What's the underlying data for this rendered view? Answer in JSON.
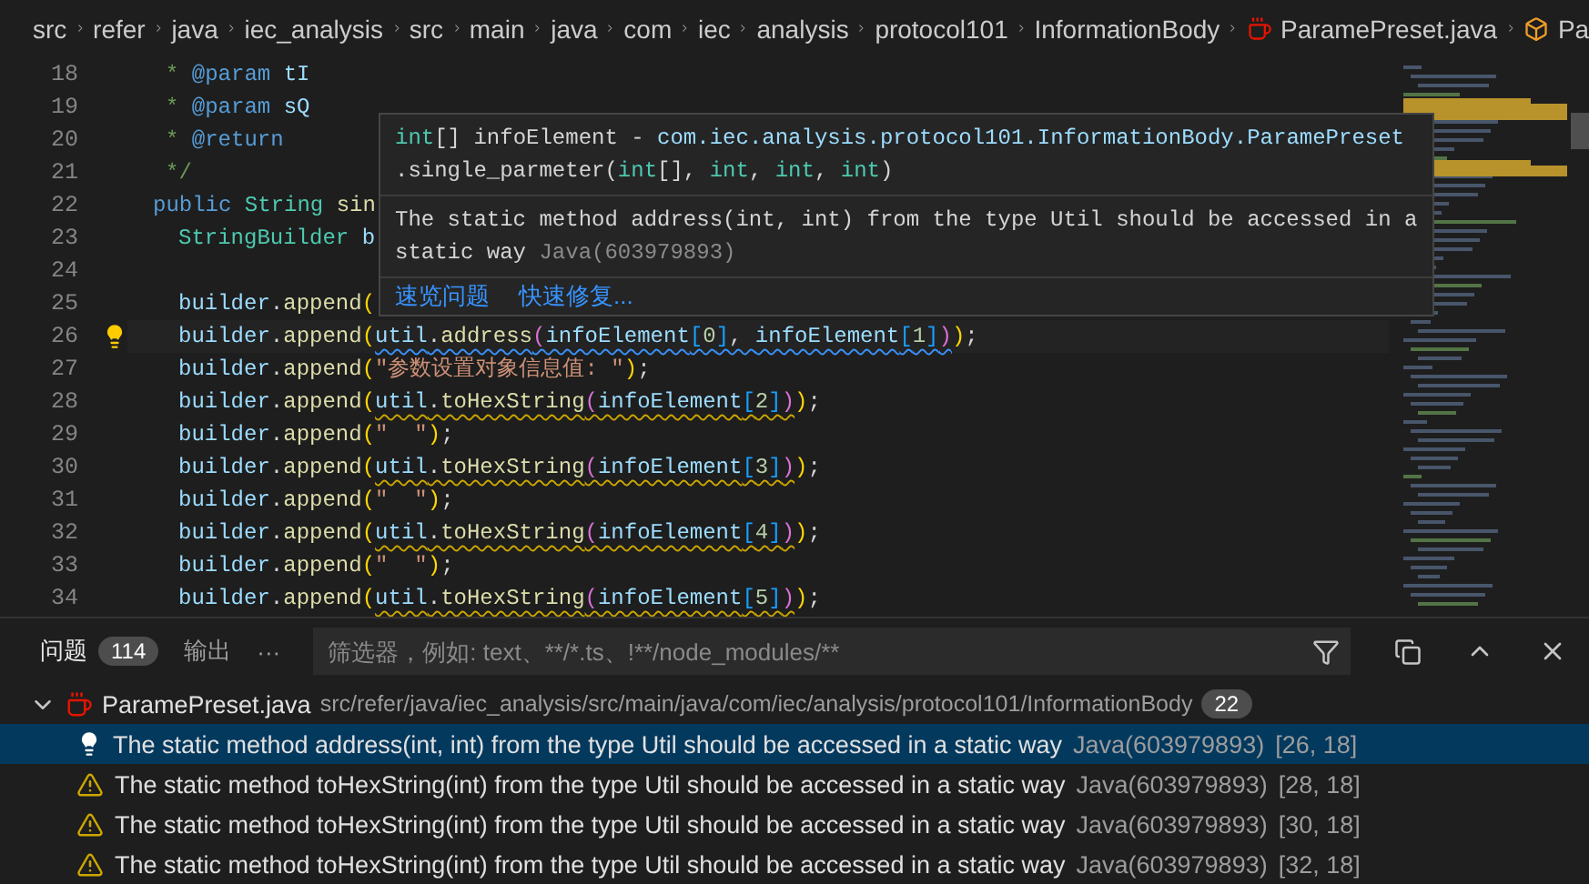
{
  "breadcrumbs": [
    {
      "label": "src",
      "kind": "folder"
    },
    {
      "label": "refer",
      "kind": "folder"
    },
    {
      "label": "java",
      "kind": "folder"
    },
    {
      "label": "iec_analysis",
      "kind": "folder"
    },
    {
      "label": "src",
      "kind": "folder"
    },
    {
      "label": "main",
      "kind": "folder"
    },
    {
      "label": "java",
      "kind": "folder"
    },
    {
      "label": "com",
      "kind": "folder"
    },
    {
      "label": "iec",
      "kind": "folder"
    },
    {
      "label": "analysis",
      "kind": "folder"
    },
    {
      "label": "protocol101",
      "kind": "folder"
    },
    {
      "label": "InformationBody",
      "kind": "folder"
    },
    {
      "label": "ParamePreset.java",
      "kind": "java"
    },
    {
      "label": "Pa",
      "kind": "symbol"
    }
  ],
  "editor": {
    "lines": [
      {
        "number": "18",
        "bulb": false,
        "kind": "doc",
        "tokens": [
          {
            "text": "* ",
            "kind": "comment"
          },
          {
            "text": "@param",
            "kind": "tag"
          },
          {
            "text": " tI",
            "kind": "var"
          }
        ]
      },
      {
        "number": "19",
        "bulb": false,
        "kind": "doc",
        "tokens": [
          {
            "text": "* ",
            "kind": "comment"
          },
          {
            "text": "@param",
            "kind": "tag"
          },
          {
            "text": " sQ",
            "kind": "var"
          }
        ]
      },
      {
        "number": "20",
        "bulb": false,
        "kind": "doc",
        "tokens": [
          {
            "text": "* ",
            "kind": "comment"
          },
          {
            "text": "@return",
            "kind": "tag"
          }
        ]
      },
      {
        "number": "21",
        "bulb": false,
        "kind": "doc",
        "tokens": [
          {
            "text": "*/",
            "kind": "comment"
          }
        ]
      },
      {
        "number": "22",
        "bulb": false,
        "kind": "decl",
        "tokens": [
          {
            "text": "public",
            "kind": "keyword"
          },
          {
            "text": " String",
            "kind": "type"
          },
          {
            "text": " sin",
            "kind": "fn"
          }
        ]
      },
      {
        "number": "23",
        "bulb": false,
        "kind": "body",
        "tokens": [
          {
            "text": "StringBuilder",
            "kind": "type"
          },
          {
            "text": " b",
            "kind": "var"
          }
        ]
      },
      {
        "number": "24",
        "bulb": false,
        "kind": "blank"
      },
      {
        "number": "25",
        "bulb": false,
        "kind": "body",
        "tokens": [
          {
            "text": "builder",
            "kind": "var"
          },
          {
            "text": ".",
            "kind": "plain"
          },
          {
            "text": "append",
            "kind": "fn"
          },
          {
            "text": "(",
            "kind": "bracket1"
          }
        ]
      },
      {
        "number": "26",
        "bulb": true,
        "kind": "body",
        "tokens": [
          {
            "text": "builder",
            "kind": "var"
          },
          {
            "text": ".",
            "kind": "plain"
          },
          {
            "text": "append",
            "kind": "fn"
          },
          {
            "text": "(",
            "kind": "bracket1"
          },
          {
            "kind": "info",
            "tokens": [
              {
                "text": "util",
                "kind": "var"
              },
              {
                "text": ".",
                "kind": "plain"
              },
              {
                "text": "address",
                "kind": "fn"
              },
              {
                "text": "(",
                "kind": "bracket2"
              },
              {
                "text": "infoElement",
                "kind": "var"
              },
              {
                "text": "[",
                "kind": "bracket3"
              },
              {
                "text": "0",
                "kind": "number"
              },
              {
                "text": "]",
                "kind": "bracket3"
              },
              {
                "text": ", ",
                "kind": "plain"
              },
              {
                "text": "infoElement",
                "kind": "var"
              },
              {
                "text": "[",
                "kind": "bracket3"
              },
              {
                "text": "1",
                "kind": "number"
              },
              {
                "text": "]",
                "kind": "bracket3"
              },
              {
                "text": ")",
                "kind": "bracket2"
              }
            ]
          },
          {
            "text": ")",
            "kind": "bracket1"
          },
          {
            "text": ";",
            "kind": "plain"
          }
        ]
      },
      {
        "number": "27",
        "bulb": false,
        "kind": "body",
        "tokens": [
          {
            "text": "builder",
            "kind": "var"
          },
          {
            "text": ".",
            "kind": "plain"
          },
          {
            "text": "append",
            "kind": "fn"
          },
          {
            "text": "(",
            "kind": "bracket1"
          },
          {
            "text": "\"参数设置对象信息值: \"",
            "kind": "string"
          },
          {
            "text": ")",
            "kind": "bracket1"
          },
          {
            "text": ";",
            "kind": "plain"
          }
        ]
      },
      {
        "number": "28",
        "bulb": false,
        "kind": "body",
        "tokens": [
          {
            "text": "builder",
            "kind": "var"
          },
          {
            "text": ".",
            "kind": "plain"
          },
          {
            "text": "append",
            "kind": "fn"
          },
          {
            "text": "(",
            "kind": "bracket1"
          },
          {
            "kind": "warning",
            "tokens": [
              {
                "text": "util",
                "kind": "var"
              },
              {
                "text": ".",
                "kind": "plain"
              },
              {
                "text": "toHexString",
                "kind": "fn"
              },
              {
                "text": "(",
                "kind": "bracket2"
              },
              {
                "text": "infoElement",
                "kind": "var"
              },
              {
                "text": "[",
                "kind": "bracket3"
              },
              {
                "text": "2",
                "kind": "number"
              },
              {
                "text": "]",
                "kind": "bracket3"
              },
              {
                "text": ")",
                "kind": "bracket2"
              }
            ]
          },
          {
            "text": ")",
            "kind": "bracket1"
          },
          {
            "text": ";",
            "kind": "plain"
          }
        ]
      },
      {
        "number": "29",
        "bulb": false,
        "kind": "body",
        "tokens": [
          {
            "text": "builder",
            "kind": "var"
          },
          {
            "text": ".",
            "kind": "plain"
          },
          {
            "text": "append",
            "kind": "fn"
          },
          {
            "text": "(",
            "kind": "bracket1"
          },
          {
            "text": "\"  \"",
            "kind": "string"
          },
          {
            "text": ")",
            "kind": "bracket1"
          },
          {
            "text": ";",
            "kind": "plain"
          }
        ]
      },
      {
        "number": "30",
        "bulb": false,
        "kind": "body",
        "tokens": [
          {
            "text": "builder",
            "kind": "var"
          },
          {
            "text": ".",
            "kind": "plain"
          },
          {
            "text": "append",
            "kind": "fn"
          },
          {
            "text": "(",
            "kind": "bracket1"
          },
          {
            "kind": "warning",
            "tokens": [
              {
                "text": "util",
                "kind": "var"
              },
              {
                "text": ".",
                "kind": "plain"
              },
              {
                "text": "toHexString",
                "kind": "fn"
              },
              {
                "text": "(",
                "kind": "bracket2"
              },
              {
                "text": "infoElement",
                "kind": "var"
              },
              {
                "text": "[",
                "kind": "bracket3"
              },
              {
                "text": "3",
                "kind": "number"
              },
              {
                "text": "]",
                "kind": "bracket3"
              },
              {
                "text": ")",
                "kind": "bracket2"
              }
            ]
          },
          {
            "text": ")",
            "kind": "bracket1"
          },
          {
            "text": ";",
            "kind": "plain"
          }
        ]
      },
      {
        "number": "31",
        "bulb": false,
        "kind": "body",
        "tokens": [
          {
            "text": "builder",
            "kind": "var"
          },
          {
            "text": ".",
            "kind": "plain"
          },
          {
            "text": "append",
            "kind": "fn"
          },
          {
            "text": "(",
            "kind": "bracket1"
          },
          {
            "text": "\"  \"",
            "kind": "string"
          },
          {
            "text": ")",
            "kind": "bracket1"
          },
          {
            "text": ";",
            "kind": "plain"
          }
        ]
      },
      {
        "number": "32",
        "bulb": false,
        "kind": "body",
        "tokens": [
          {
            "text": "builder",
            "kind": "var"
          },
          {
            "text": ".",
            "kind": "plain"
          },
          {
            "text": "append",
            "kind": "fn"
          },
          {
            "text": "(",
            "kind": "bracket1"
          },
          {
            "kind": "warning",
            "tokens": [
              {
                "text": "util",
                "kind": "var"
              },
              {
                "text": ".",
                "kind": "plain"
              },
              {
                "text": "toHexString",
                "kind": "fn"
              },
              {
                "text": "(",
                "kind": "bracket2"
              },
              {
                "text": "infoElement",
                "kind": "var"
              },
              {
                "text": "[",
                "kind": "bracket3"
              },
              {
                "text": "4",
                "kind": "number"
              },
              {
                "text": "]",
                "kind": "bracket3"
              },
              {
                "text": ")",
                "kind": "bracket2"
              }
            ]
          },
          {
            "text": ")",
            "kind": "bracket1"
          },
          {
            "text": ";",
            "kind": "plain"
          }
        ]
      },
      {
        "number": "33",
        "bulb": false,
        "kind": "body",
        "tokens": [
          {
            "text": "builder",
            "kind": "var"
          },
          {
            "text": ".",
            "kind": "plain"
          },
          {
            "text": "append",
            "kind": "fn"
          },
          {
            "text": "(",
            "kind": "bracket1"
          },
          {
            "text": "\"  \"",
            "kind": "string"
          },
          {
            "text": ")",
            "kind": "bracket1"
          },
          {
            "text": ";",
            "kind": "plain"
          }
        ]
      },
      {
        "number": "34",
        "bulb": false,
        "kind": "body",
        "tokens": [
          {
            "text": "builder",
            "kind": "var"
          },
          {
            "text": ".",
            "kind": "plain"
          },
          {
            "text": "append",
            "kind": "fn"
          },
          {
            "text": "(",
            "kind": "bracket1"
          },
          {
            "kind": "warning",
            "tokens": [
              {
                "text": "util",
                "kind": "var"
              },
              {
                "text": ".",
                "kind": "plain"
              },
              {
                "text": "toHexString",
                "kind": "fn"
              },
              {
                "text": "(",
                "kind": "bracket2"
              },
              {
                "text": "infoElement",
                "kind": "var"
              },
              {
                "text": "[",
                "kind": "bracket3"
              },
              {
                "text": "5",
                "kind": "number"
              },
              {
                "text": "]",
                "kind": "bracket3"
              },
              {
                "text": ")",
                "kind": "bracket2"
              }
            ]
          },
          {
            "text": ")",
            "kind": "bracket1"
          },
          {
            "text": ";",
            "kind": "plain"
          }
        ]
      }
    ]
  },
  "hover": {
    "signature": [
      {
        "text": "int",
        "kind": "type"
      },
      {
        "text": "[] infoElement - ",
        "kind": "plain"
      },
      {
        "text": "com.iec.analysis.protocol101.InformationBody.ParamePreset",
        "kind": "var"
      },
      {
        "text": "\n.single_parmeter(",
        "kind": "plain"
      },
      {
        "text": "int",
        "kind": "type"
      },
      {
        "text": "[], ",
        "kind": "plain"
      },
      {
        "text": "int",
        "kind": "type"
      },
      {
        "text": ", ",
        "kind": "plain"
      },
      {
        "text": "int",
        "kind": "type"
      },
      {
        "text": ", ",
        "kind": "plain"
      },
      {
        "text": "int",
        "kind": "type"
      },
      {
        "text": ")",
        "kind": "plain"
      }
    ],
    "message": "The static method address(int, int) from the type Util should be accessed in a static way",
    "source": "Java(603979893)",
    "actions": [
      "速览问题",
      "快速修复..."
    ]
  },
  "panel": {
    "tabs": [
      {
        "label": "问题",
        "badge": "114",
        "selected": true
      },
      {
        "label": "输出",
        "selected": false
      }
    ],
    "more": "···",
    "filter": {
      "placeholder": "筛选器，例如: text、**/*.ts、!**/node_modules/**"
    },
    "file": {
      "name": "ParamePreset.java",
      "path": "src/refer/java/iec_analysis/src/main/java/com/iec/analysis/protocol101/InformationBody",
      "count": "22",
      "expanded": true
    },
    "problems": [
      {
        "kind": "info",
        "message": "The static method address(int, int) from the type Util should be accessed in a static way",
        "source": "Java(603979893)",
        "position": "[26, 18]",
        "selected": true
      },
      {
        "kind": "warning",
        "message": "The static method toHexString(int) from the type Util should be accessed in a static way",
        "source": "Java(603979893)",
        "position": "[28, 18]",
        "selected": false
      },
      {
        "kind": "warning",
        "message": "The static method toHexString(int) from the type Util should be accessed in a static way",
        "source": "Java(603979893)",
        "position": "[30, 18]",
        "selected": false
      },
      {
        "kind": "warning",
        "message": "The static method toHexString(int) from the type Util should be accessed in a static way",
        "source": "Java(603979893)",
        "position": "[32, 18]",
        "selected": false
      }
    ]
  }
}
